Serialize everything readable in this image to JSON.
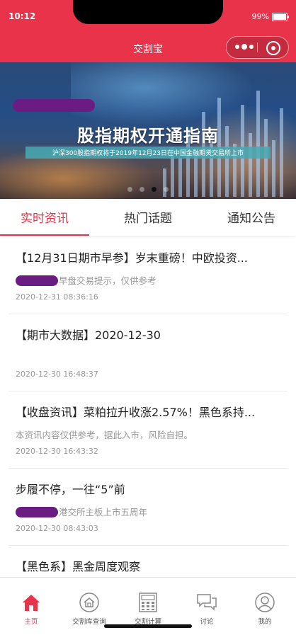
{
  "status_bar": {
    "time": "10:12",
    "battery": "99%"
  },
  "header": {
    "title": "交割宝"
  },
  "banner": {
    "headline": "股指期权开通指南",
    "subtitle": "沪深300股指期权将于2019年12月23日在中国金融期货交易所上市",
    "slides": 4,
    "active_slide": 3
  },
  "tabs": [
    {
      "label": "实时资讯",
      "active": true
    },
    {
      "label": "热门话题",
      "active": false
    },
    {
      "label": "通知公告",
      "active": false
    }
  ],
  "news": [
    {
      "title": "【12月31日期市早参】岁末重磅！中欧投资...",
      "desc": "早盘交易提示，仅供参考",
      "time": "2020-12-31 08:36:16",
      "masked": true
    },
    {
      "title": "【期市大数据】2020-12-30",
      "desc": "",
      "time": "2020-12-30 16:48:37",
      "masked": false
    },
    {
      "title": "【收盘资讯】菜粕拉升收涨2.57%！黑色系持...",
      "desc": "本资讯内容仅供参考，据此入市，风险自担。",
      "time": "2020-12-30 16:43:32",
      "masked": false
    },
    {
      "title": "步履不停，一往“5”前",
      "desc": "港交所主板上市五周年",
      "time": "2020-12-30 08:43:03",
      "masked": true
    },
    {
      "title": "【黑色系】黑金周度观察",
      "desc": "",
      "time": "",
      "masked": false
    }
  ],
  "bottom_nav": [
    {
      "label": "主页",
      "icon": "home-icon",
      "active": true
    },
    {
      "label": "交割库查询",
      "icon": "warehouse-icon",
      "active": false
    },
    {
      "label": "交割计算",
      "icon": "calculator-icon",
      "active": false
    },
    {
      "label": "讨论",
      "icon": "chat-icon",
      "active": false
    },
    {
      "label": "我的",
      "icon": "user-icon",
      "active": false
    }
  ],
  "colors": {
    "brand": "#e8334b",
    "mask": "#6a1c82"
  }
}
